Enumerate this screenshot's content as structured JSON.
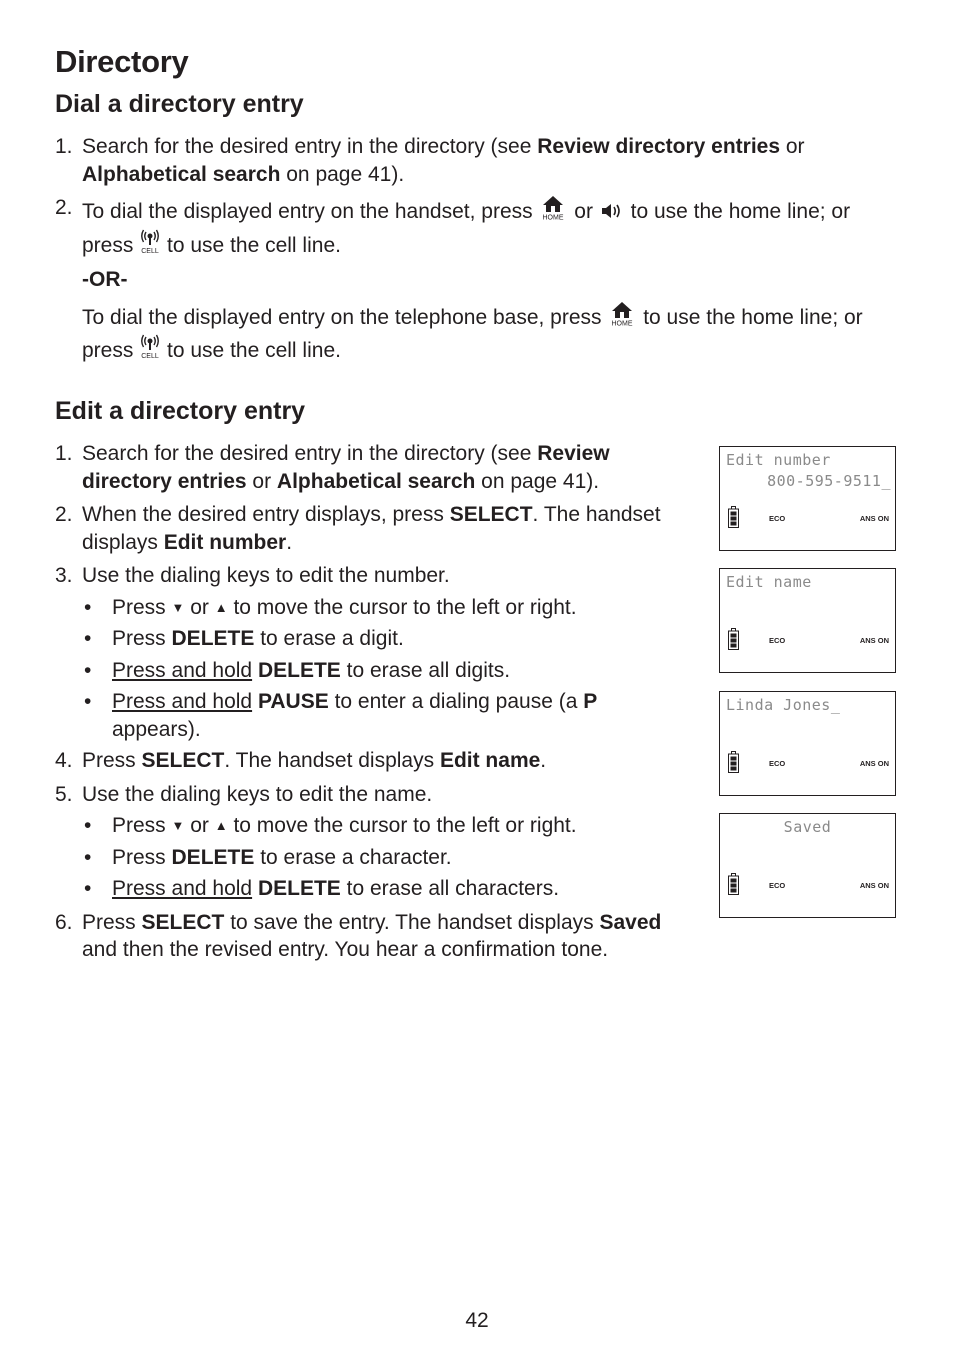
{
  "page": {
    "title": "Directory",
    "number": "42"
  },
  "dial_section": {
    "heading": "Dial a directory entry",
    "step1": {
      "num": "1.",
      "t1": "Search for the desired entry in the directory (see ",
      "b1": "Review directory entries",
      "t2": " or ",
      "b2": "Alphabetical search",
      "t3": " on page 41)."
    },
    "step2": {
      "num": "2.",
      "t1": "To dial the displayed entry on the handset, press ",
      "t2": " or ",
      "t3": " to use the home line; or press ",
      "t4": " to use the cell line.",
      "or_label": "-OR-",
      "t5": "To dial the displayed entry on the telephone base, press ",
      "t6": " to use the home line; or press ",
      "t7": " to use the cell line."
    },
    "icons": {
      "home": "home-key-icon",
      "speaker": "speaker-key-icon",
      "cell": "cell-key-icon",
      "home_label": "HOME",
      "cell_label": "CELL"
    }
  },
  "edit_section": {
    "heading": "Edit a directory entry",
    "steps": [
      {
        "num": "1.",
        "t1": "Search for the desired entry in the directory (see ",
        "b1": "Review directory entries",
        "t2": " or ",
        "b2": "Alphabetical search",
        "t3": " on page 41)."
      },
      {
        "num": "2.",
        "t1": "When the desired entry displays, press ",
        "b1": "SELECT",
        "t2": ". The handset displays ",
        "b2": "Edit number",
        "t3": "."
      },
      {
        "num": "3.",
        "t1": "Use the dialing keys to edit the number."
      },
      {
        "num": "4.",
        "t1": "Press ",
        "b1": "SELECT",
        "t2": ". The handset displays ",
        "b2": "Edit name",
        "t3": "."
      },
      {
        "num": "5.",
        "t1": "Use the dialing keys to edit the name."
      },
      {
        "num": "6.",
        "t1": "Press ",
        "b1": "SELECT",
        "t2": " to save the entry. The handset displays ",
        "b2": "Saved",
        "t3": " and then the revised entry. You hear a confirmation tone."
      }
    ],
    "step3_bullets": [
      {
        "t1": "Press ",
        "down": "▼",
        "t2": " or ",
        "up": "▲",
        "t3": " to move the cursor to the left or right."
      },
      {
        "t1": "Press ",
        "b1": "DELETE",
        "t2": " to erase a digit."
      },
      {
        "u1": "Press and hold",
        "t1": " ",
        "b1": "DELETE",
        "t2": " to erase all digits."
      },
      {
        "u1": "Press and hold",
        "t1": " ",
        "b1": "PAUSE",
        "t2": " to enter a dialing pause (a ",
        "b2": "P",
        "t3": " appears)."
      }
    ],
    "step5_bullets": [
      {
        "t1": "Press ",
        "down": "▼",
        "t2": " or ",
        "up": "▲",
        "t3": " to move the cursor to the left or right."
      },
      {
        "t1": "Press ",
        "b1": "DELETE",
        "t2": " to erase a character."
      },
      {
        "u1": "Press and hold",
        "t1": " ",
        "b1": "DELETE",
        "t2": " to erase all characters."
      }
    ],
    "bullet_char": "•"
  },
  "lcd_screens": [
    {
      "line1": "Edit number",
      "line2": "800-595-9511_",
      "eco": "ECO",
      "ans": "ANS ON"
    },
    {
      "line1": "Edit name",
      "line2": "",
      "eco": "ECO",
      "ans": "ANS ON"
    },
    {
      "line1": "Linda Jones_",
      "line2": "",
      "eco": "ECO",
      "ans": "ANS ON"
    },
    {
      "line1": "Saved",
      "line2": "",
      "eco": "ECO",
      "ans": "ANS ON"
    }
  ]
}
